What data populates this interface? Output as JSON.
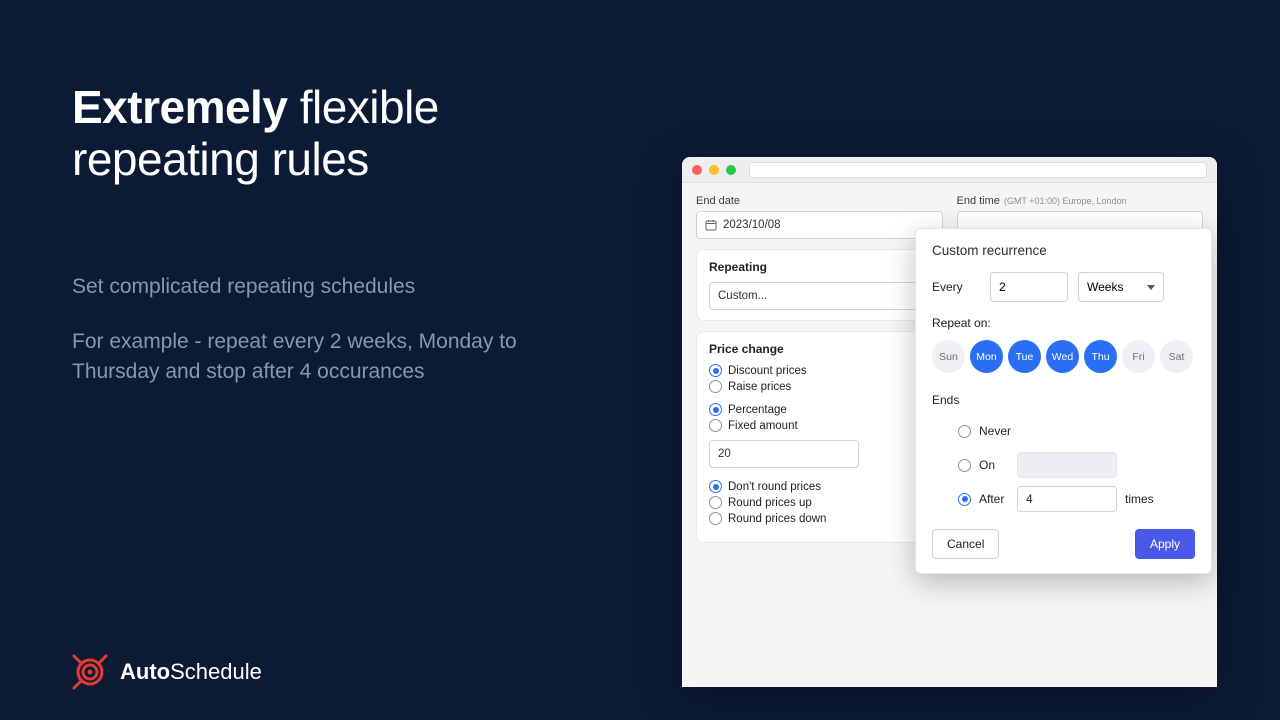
{
  "marketing": {
    "headline_bold": "Extremely",
    "headline_rest": " flexible repeating rules",
    "sub1": "Set complicated repeating schedules",
    "sub2": "For example - repeat every 2 weeks, Monday to Thursday and stop after 4 occurances"
  },
  "brand": {
    "first": "Auto",
    "second": "Schedule"
  },
  "form": {
    "end_date_label": "End date",
    "end_date_value": "2023/10/08",
    "end_time_label": "End time",
    "end_time_tz": "(GMT +01:00) Europe, London",
    "repeating_label": "Repeating",
    "repeating_value": "Custom...",
    "price_change_label": "Price change",
    "price_mode": {
      "discount": "Discount prices",
      "raise": "Raise prices"
    },
    "price_type": {
      "percentage": "Percentage",
      "fixed": "Fixed amount"
    },
    "amount_value": "20",
    "rounding": {
      "none": "Don't round prices",
      "up": "Round prices up",
      "down": "Round prices down"
    }
  },
  "popover": {
    "title": "Custom recurrence",
    "every_label": "Every",
    "every_value": "2",
    "unit_value": "Weeks",
    "repeat_on_label": "Repeat on:",
    "days": [
      {
        "abbr": "Sun",
        "on": false
      },
      {
        "abbr": "Mon",
        "on": true
      },
      {
        "abbr": "Tue",
        "on": true
      },
      {
        "abbr": "Wed",
        "on": true
      },
      {
        "abbr": "Thu",
        "on": true
      },
      {
        "abbr": "Fri",
        "on": false
      },
      {
        "abbr": "Sat",
        "on": false
      }
    ],
    "ends_label": "Ends",
    "ends": {
      "never": "Never",
      "on": "On",
      "after": "After",
      "after_value": "4",
      "after_suffix": "times"
    },
    "cancel": "Cancel",
    "apply": "Apply"
  }
}
